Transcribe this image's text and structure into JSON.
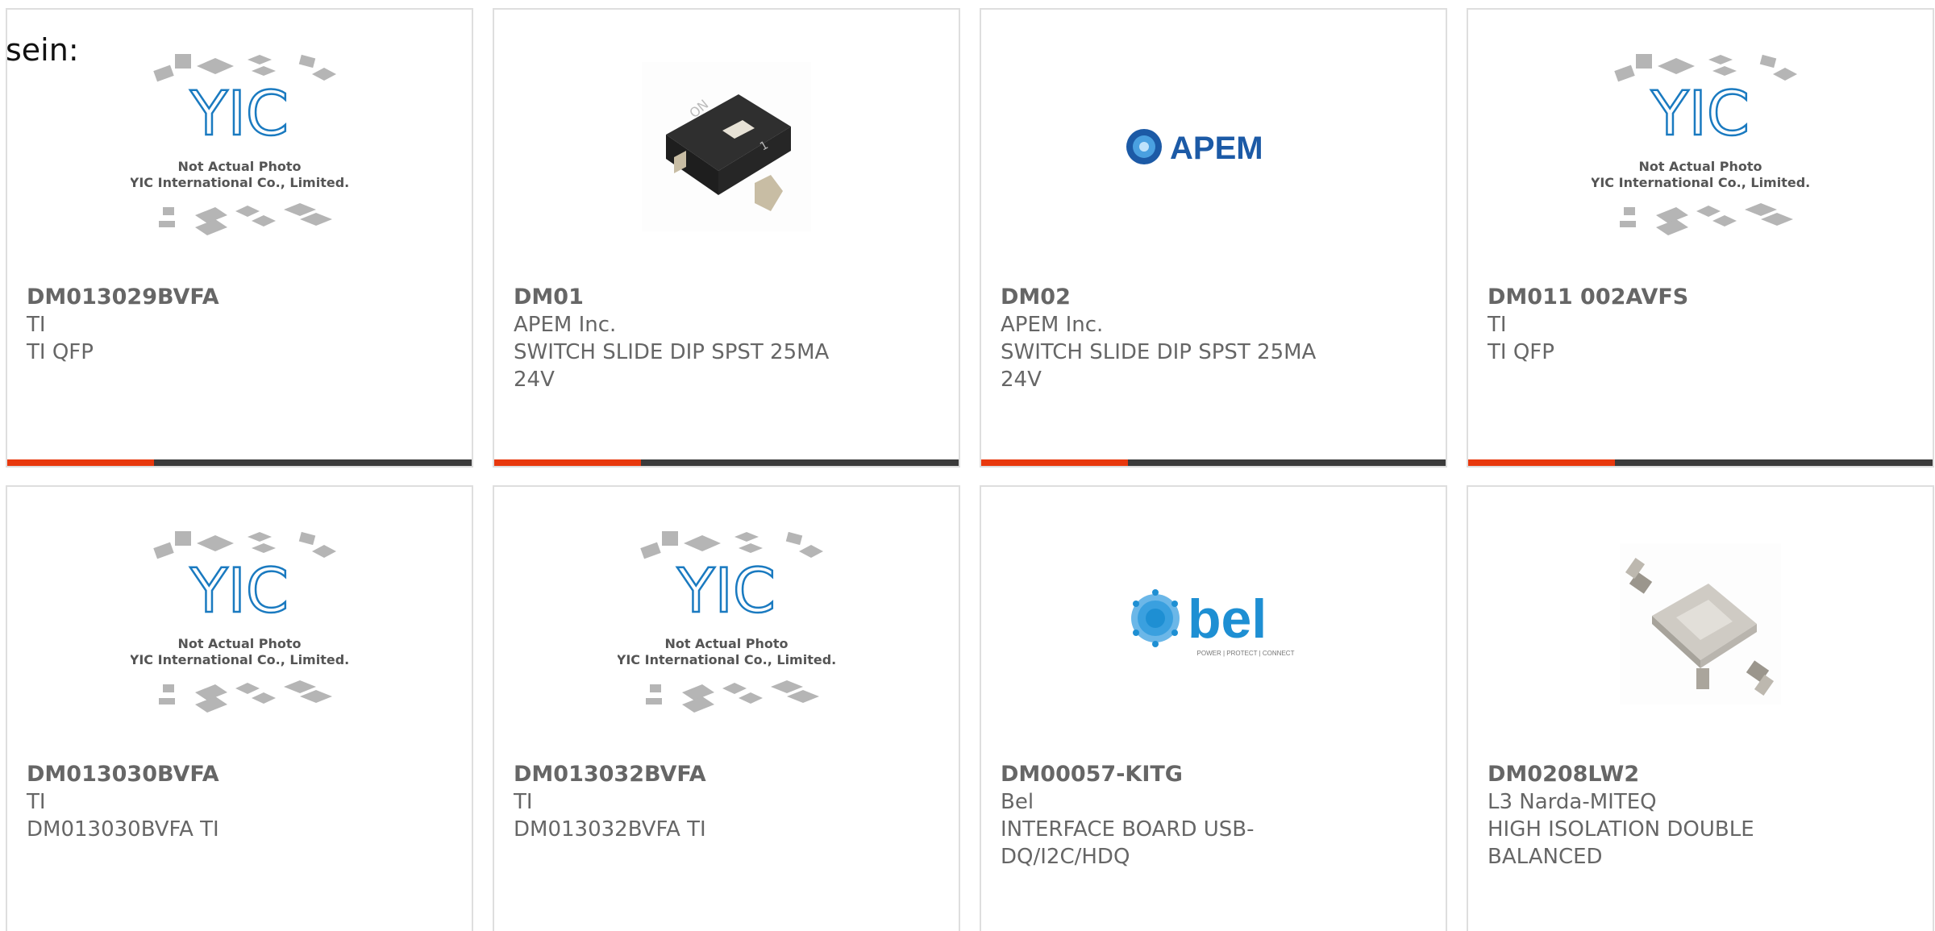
{
  "fragment_text": "sein:",
  "colors": {
    "card_border": "#dedede",
    "text": "#666666",
    "accent_bar": "#e8380d",
    "dark_bar": "#3b3b3b",
    "yic_blue": "#1a7ac0",
    "apem_blue": "#1c5aa6",
    "bel_blue": "#1e8fd3"
  },
  "placeholder_image": {
    "brand": "YIC",
    "line1": "Not Actual Photo",
    "line2": "YIC International Co., Limited."
  },
  "apem_logo_text": "APEM",
  "bel_logo": {
    "text": "bel",
    "tagline": "POWER | PROTECT | CONNECT"
  },
  "products": [
    {
      "part": "DM013029BVFA",
      "maker": "TI",
      "desc1": "TI QFP",
      "desc2": "",
      "image": "yic-placeholder"
    },
    {
      "part": "DM01",
      "maker": "APEM Inc.",
      "desc1": "SWITCH SLIDE DIP SPST 25MA",
      "desc2": "24V",
      "image": "dip-switch-photo"
    },
    {
      "part": "DM02",
      "maker": "APEM Inc.",
      "desc1": "SWITCH SLIDE DIP SPST 25MA",
      "desc2": "24V",
      "image": "apem-logo"
    },
    {
      "part": "DM011 002AVFS",
      "maker": "TI",
      "desc1": "TI QFP",
      "desc2": "",
      "image": "yic-placeholder"
    },
    {
      "part": "DM013030BVFA",
      "maker": "TI",
      "desc1": "DM013030BVFA TI",
      "desc2": "",
      "image": "yic-placeholder"
    },
    {
      "part": "DM013032BVFA",
      "maker": "TI",
      "desc1": "DM013032BVFA TI",
      "desc2": "",
      "image": "yic-placeholder"
    },
    {
      "part": "DM00057-KITG",
      "maker": "Bel",
      "desc1": "INTERFACE BOARD USB-",
      "desc2": "DQ/I2C/HDQ",
      "image": "bel-logo"
    },
    {
      "part": "DM0208LW2",
      "maker": "L3 Narda-MITEQ",
      "desc1": "HIGH ISOLATION DOUBLE",
      "desc2": "BALANCED",
      "image": "rf-mixer-photo"
    }
  ]
}
